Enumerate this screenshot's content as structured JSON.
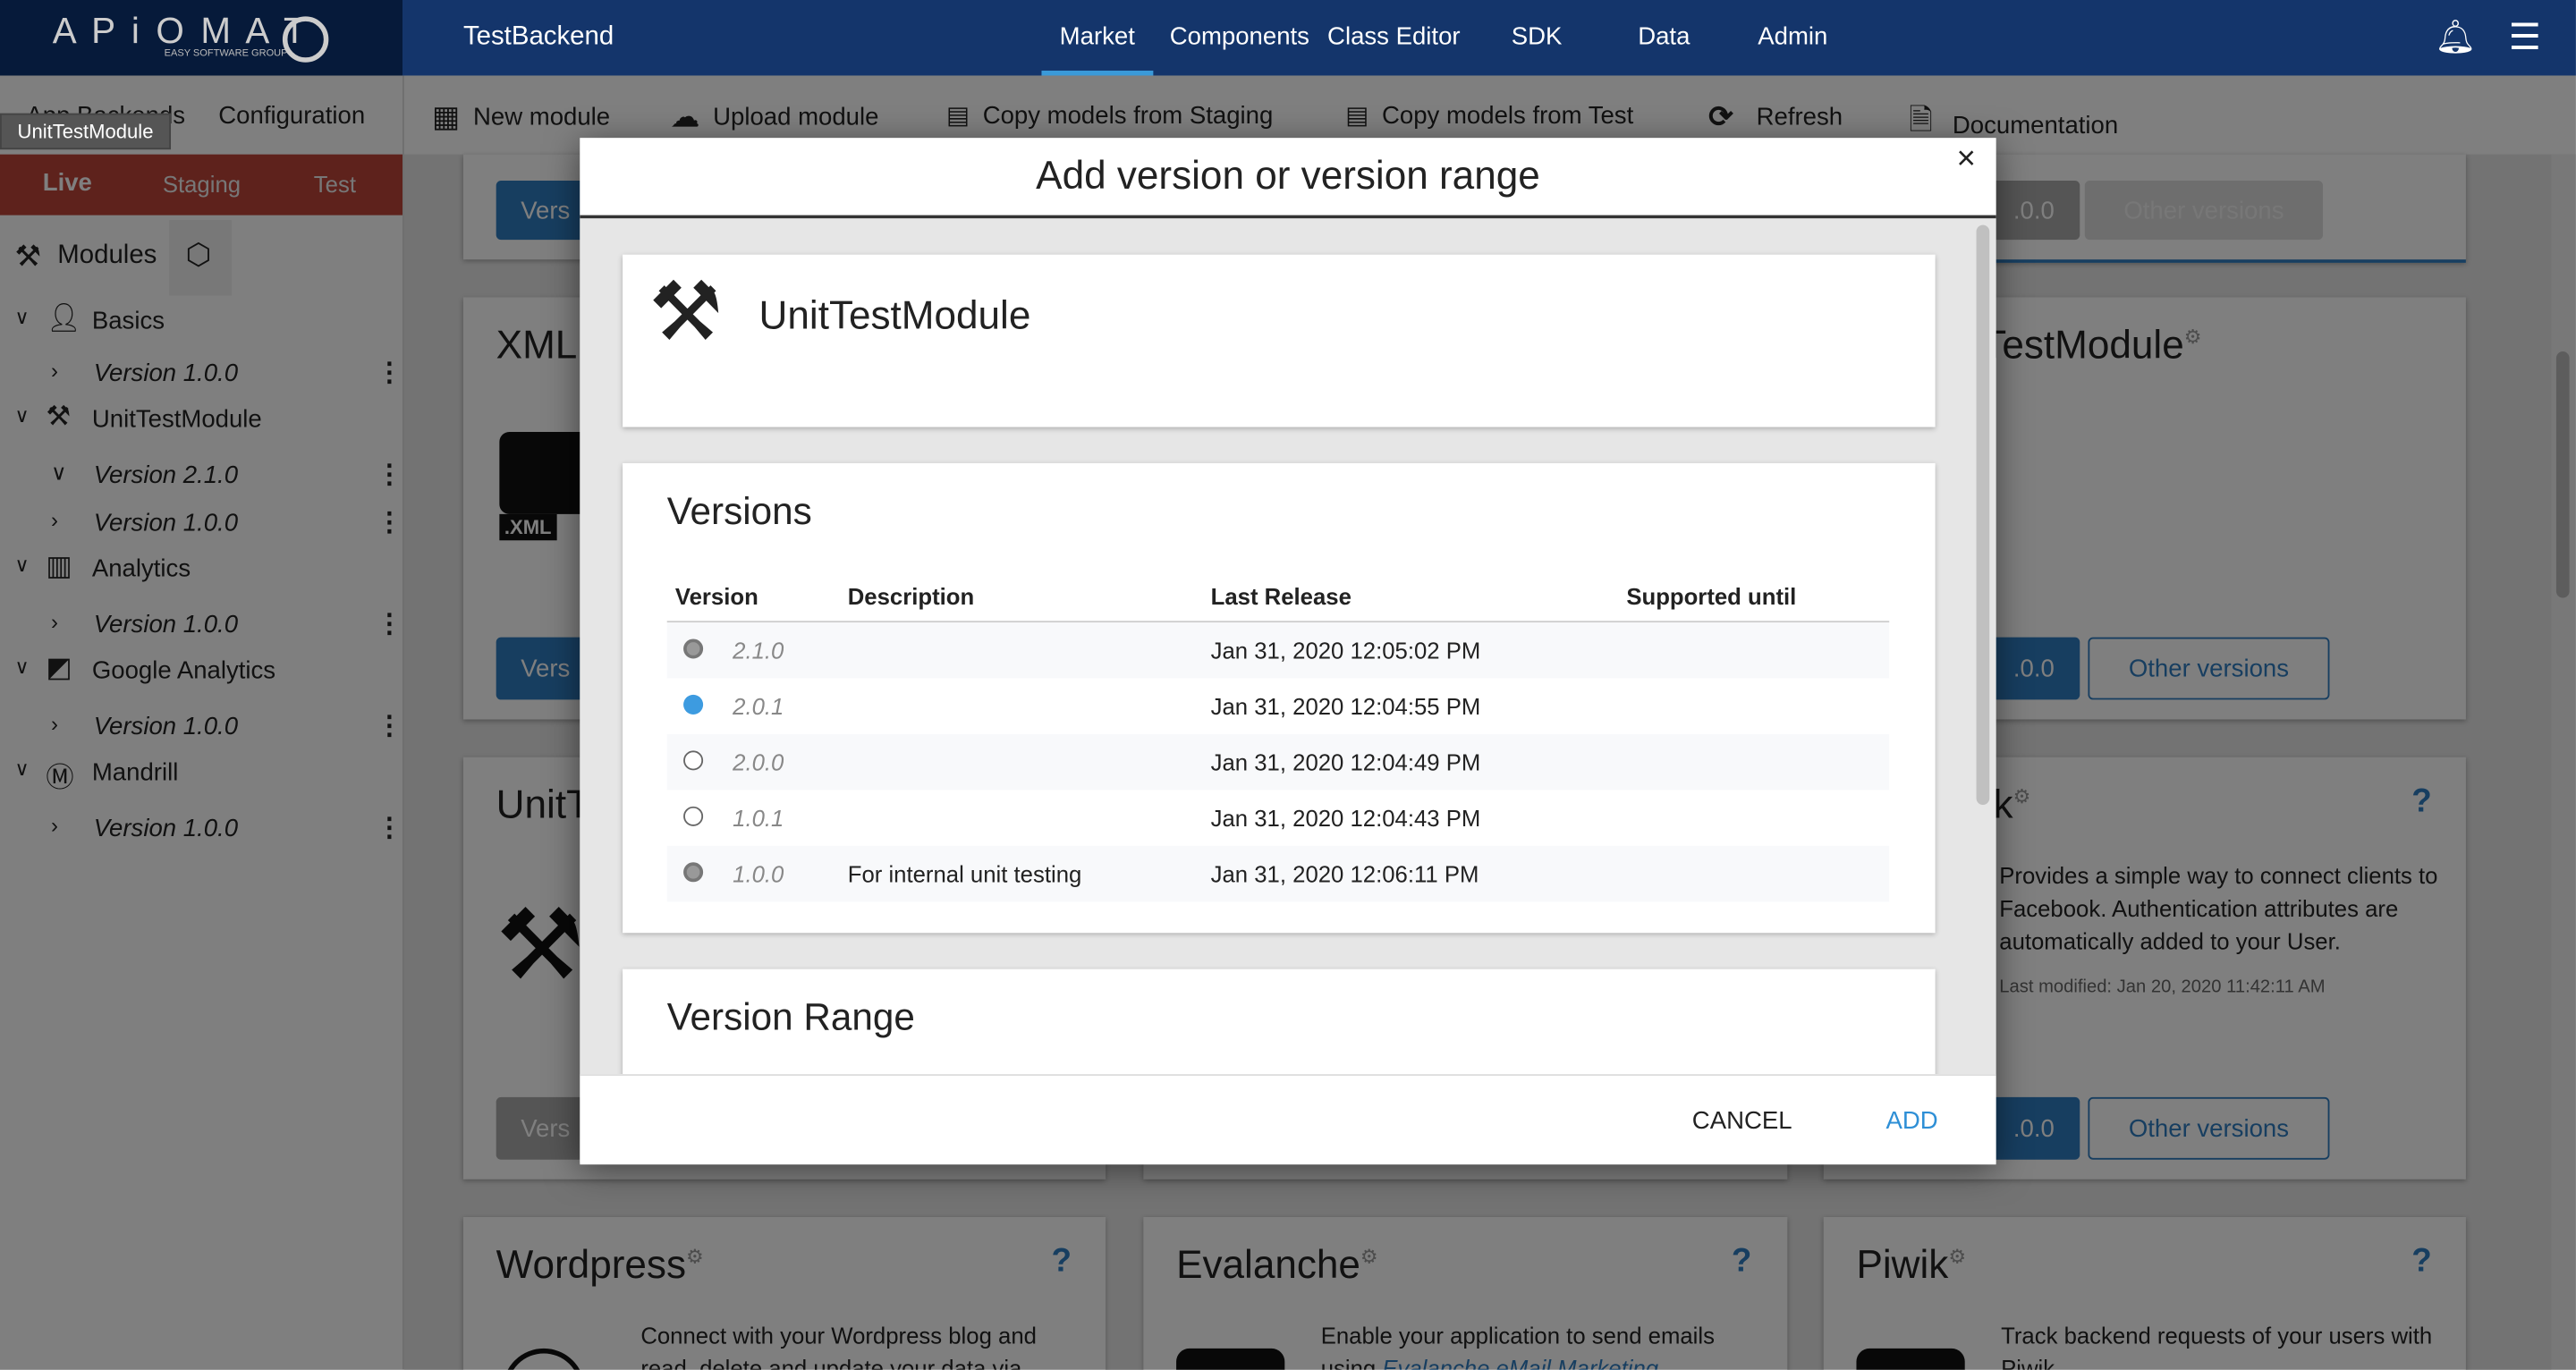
{
  "header": {
    "logo_text": "APIOMAT",
    "logo_sub": "EASY SOFTWARE GROUP",
    "app_name": "TestBackend",
    "nav": [
      "Market",
      "Components",
      "Class Editor",
      "SDK",
      "Data",
      "Admin"
    ],
    "active_nav": "Market",
    "icons": [
      "bell-icon",
      "hamburger-menu-icon"
    ],
    "accent": "#3a9ad9",
    "bg": "#14356b"
  },
  "sidebar": {
    "tabs": [
      "App Backends",
      "Configuration"
    ],
    "tooltip": "UnitTestModule",
    "envs": [
      "Live",
      "Staging",
      "Test"
    ],
    "active_env": "Live",
    "env_color": "#bc4438",
    "modules_label": "Modules",
    "tree": [
      {
        "name": "Basics",
        "icon": "user-icon",
        "versions": [
          "Version 1.0.0"
        ]
      },
      {
        "name": "UnitTestModule",
        "icon": "tools-icon",
        "versions": [
          "Version 2.1.0",
          "Version 1.0.0"
        ]
      },
      {
        "name": "Analytics",
        "icon": "bar-chart-icon",
        "versions": [
          "Version 1.0.0"
        ]
      },
      {
        "name": "Google Analytics",
        "icon": "line-chart-icon",
        "versions": [
          "Version 1.0.0"
        ]
      },
      {
        "name": "Mandrill",
        "icon": "mandrill-icon",
        "versions": [
          "Version 1.0.0"
        ]
      }
    ]
  },
  "toolbar": {
    "items": [
      {
        "label": "New module",
        "icon": "grid-icon"
      },
      {
        "label": "Upload module",
        "icon": "cloud-upload-icon"
      },
      {
        "label": "Copy models from Staging",
        "icon": "copy-models-icon"
      },
      {
        "label": "Copy models from Test",
        "icon": "copy-models-icon"
      },
      {
        "label": "Refresh",
        "icon": "refresh-icon"
      },
      {
        "label": "Documentation",
        "icon": "documentation-icon"
      }
    ]
  },
  "cards": {
    "version_btn": "Vers",
    "version_suffix": ".0.0",
    "other_versions": "Other versions",
    "xml_title": "XML",
    "xml_badge": ".XML",
    "unit_title_left": "UnitT",
    "unit_title_right": "tTestModule",
    "fb_title": "ok",
    "fb_desc": "Provides a simple way to connect clients to Facebook. Authentication attributes are automatically added to your User.",
    "fb_modified": "Last modified: Jan 20, 2020 11:42:11 AM",
    "wordpress_title": "Wordpress",
    "wordpress_desc": "Connect with your Wordpress blog and read, delete and update your data via",
    "evalanche_title": "Evalanche",
    "evalanche_desc": "Enable your application to send emails using",
    "evalanche_link": "Evalanche eMail Marketing",
    "piwik_title": "Piwik",
    "piwik_desc": "Track backend requests of your users with Piwik",
    "help": "?"
  },
  "modal": {
    "title": "Add version or version range",
    "close": "×",
    "module_name": "UnitTestModule",
    "versions_heading": "Versions",
    "columns": [
      "Version",
      "Description",
      "Last Release",
      "Supported until"
    ],
    "rows": [
      {
        "version": "2.1.0",
        "description": "",
        "last_release": "Jan 31, 2020 12:05:02 PM",
        "supported_until": "",
        "state": "disabled"
      },
      {
        "version": "2.0.1",
        "description": "",
        "last_release": "Jan 31, 2020 12:04:55 PM",
        "supported_until": "",
        "state": "selected"
      },
      {
        "version": "2.0.0",
        "description": "",
        "last_release": "Jan 31, 2020 12:04:49 PM",
        "supported_until": "",
        "state": "unselected"
      },
      {
        "version": "1.0.1",
        "description": "",
        "last_release": "Jan 31, 2020 12:04:43 PM",
        "supported_until": "",
        "state": "unselected"
      },
      {
        "version": "1.0.0",
        "description": "For internal unit testing",
        "last_release": "Jan 31, 2020 12:06:11 PM",
        "supported_until": "",
        "state": "disabled"
      }
    ],
    "range_heading": "Version Range",
    "cancel": "CANCEL",
    "add": "ADD",
    "selected_color": "#3d9be0"
  }
}
